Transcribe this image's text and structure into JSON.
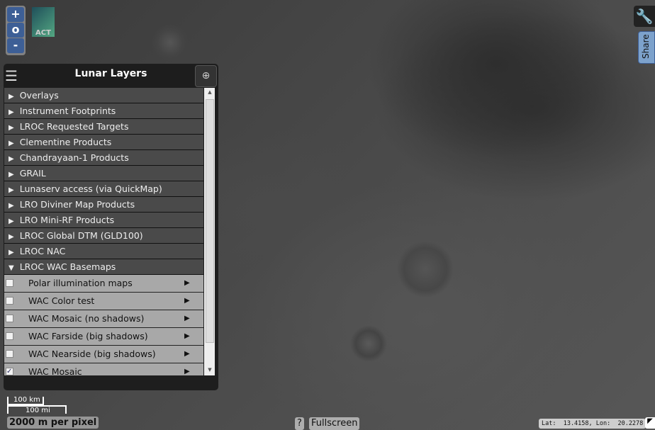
{
  "zoom": {
    "in": "+",
    "reset": "o",
    "out": "-"
  },
  "logo": "ACT",
  "panel": {
    "title": "Lunar Layers",
    "groups": [
      "Overlays",
      "Instrument Footprints",
      "LROC Requested Targets",
      "Clementine Products",
      "Chandrayaan-1 Products",
      "GRAIL",
      "Lunaserv access (via QuickMap)",
      "LRO Diviner Map Products",
      "LRO Mini-RF Products",
      "LROC Global DTM (GLD100)",
      "LROC NAC",
      "LROC WAC Basemaps"
    ],
    "expanded_group": "LROC WAC Basemaps",
    "basemaps": [
      {
        "label": "Polar illumination maps",
        "checked": false
      },
      {
        "label": "WAC Color test",
        "checked": false
      },
      {
        "label": "WAC Mosaic (no shadows)",
        "checked": false
      },
      {
        "label": "WAC Farside (big shadows)",
        "checked": false
      },
      {
        "label": "WAC Nearside (big shadows)",
        "checked": false
      },
      {
        "label": "WAC Mosaic",
        "checked": true
      }
    ]
  },
  "scale": {
    "km": "100 km",
    "mi": "100 mi",
    "resolution": "2000 m per pixel"
  },
  "help": "?",
  "fullscreen": "Fullscreen",
  "coords": "Lat:  13.4158, Lon:  20.2278",
  "share": "Share"
}
